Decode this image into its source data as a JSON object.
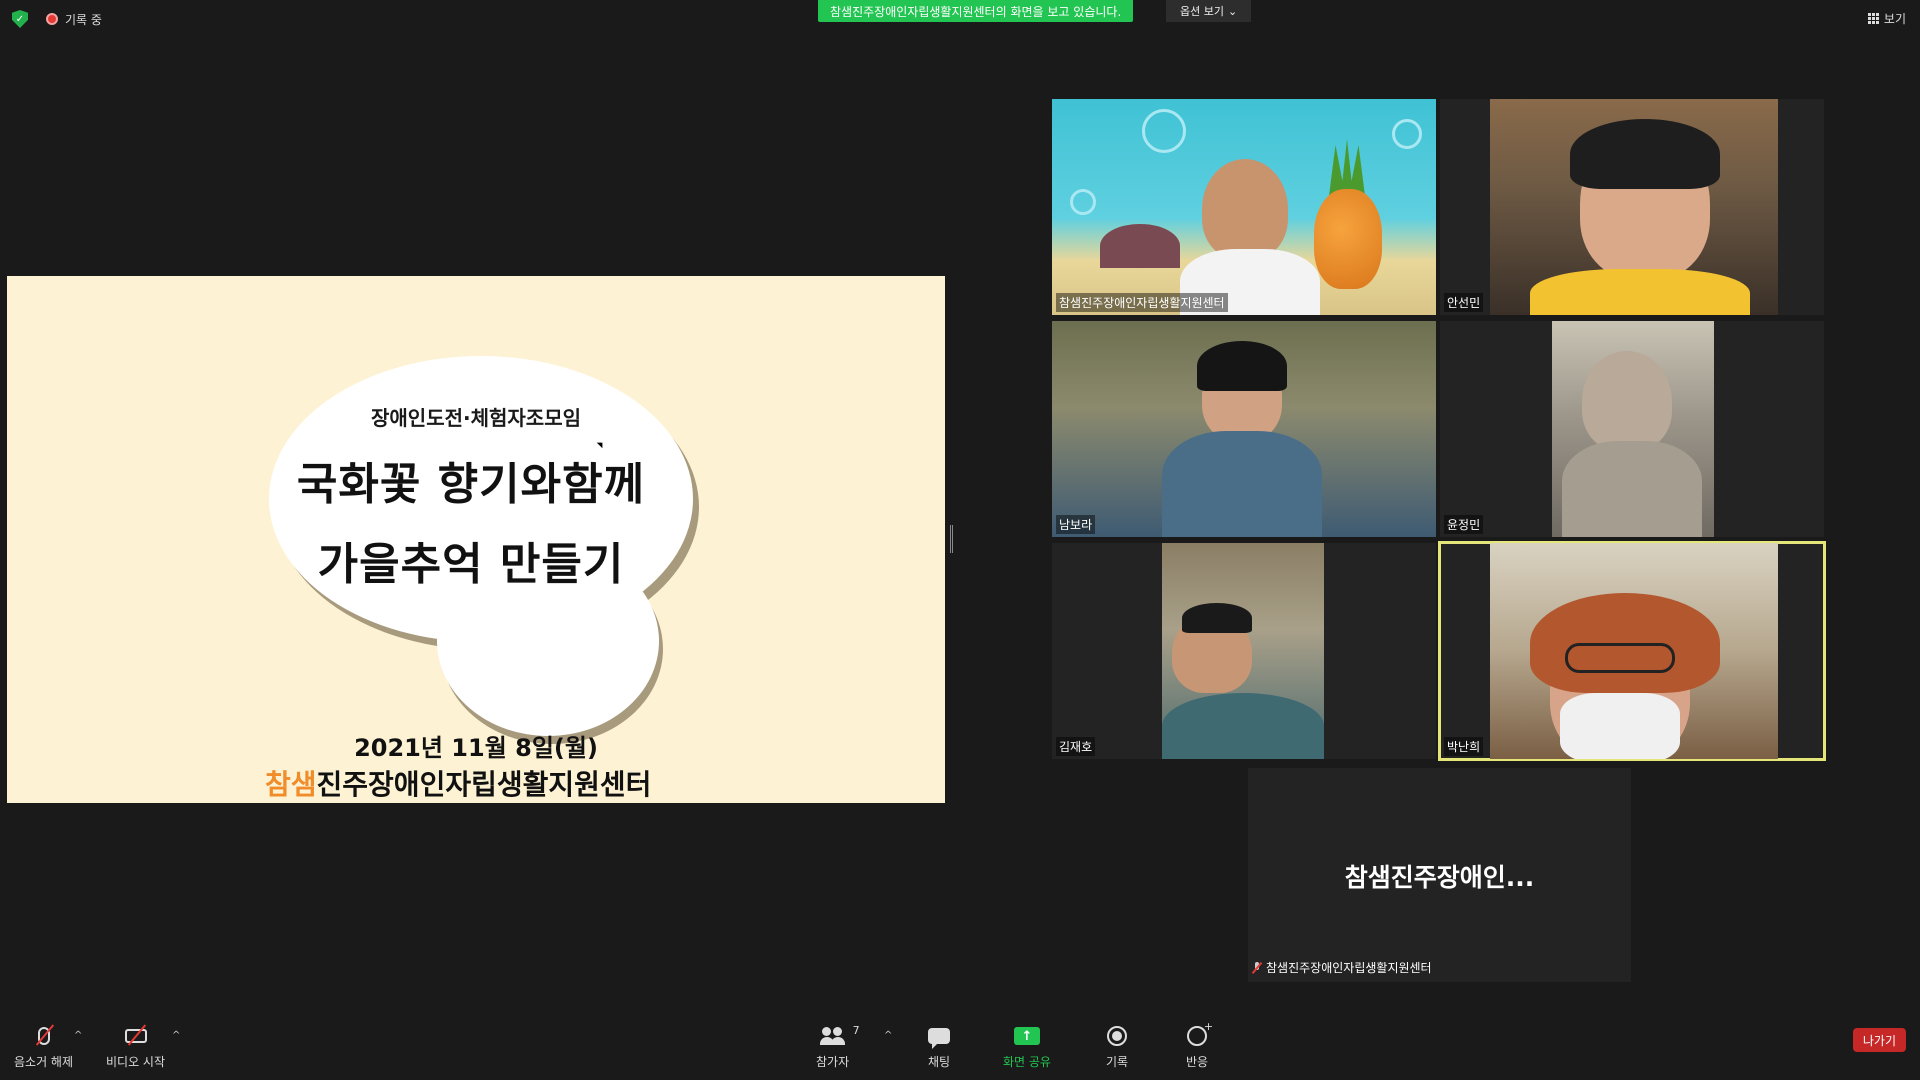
{
  "header": {
    "recording_label": "기록 중",
    "view_banner": "참샘진주장애인자립생활지원센터의 화면을 보고 있습니다.",
    "view_options": "옵션 보기",
    "view_label": "보기"
  },
  "slide": {
    "subtitle": "장애인도전·체험자조모임",
    "title_line1": "국화꽃 향기와함께",
    "title_line2": "가을추억 만들기",
    "date": "2021년 11월 8일(월)",
    "org_brand": "참샘",
    "org_name": "진주장애인자립생활지원센터"
  },
  "participants": [
    {
      "name": "참샘진주장애인자립생활지원센터"
    },
    {
      "name": "안선민"
    },
    {
      "name": "남보라"
    },
    {
      "name": "윤정민"
    },
    {
      "name": "김재호"
    },
    {
      "name": "박난희"
    }
  ],
  "no_video_tile": {
    "display_name": "참샘진주장애인...",
    "name": "참샘진주장애인자립생활지원센터"
  },
  "toolbar": {
    "unmute": "음소거 해제",
    "start_video": "비디오 시작",
    "participants": "참가자",
    "participants_count": "7",
    "chat": "채팅",
    "share_screen": "화면 공유",
    "record": "기록",
    "reactions": "반응",
    "leave": "나가기"
  },
  "colors": {
    "accent_green": "#23c552",
    "active_speaker": "#e5e67a",
    "leave_red": "#c62828",
    "brand_orange": "#f08c2a"
  }
}
